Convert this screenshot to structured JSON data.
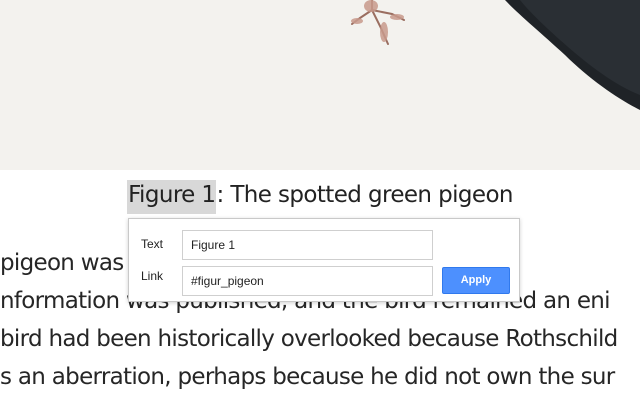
{
  "caption": {
    "figure_label": "Figure 1",
    "rest": ": The spotted green pigeon"
  },
  "body_lines": [
    "pigeon was                                              the  literatu",
    "nformation was published, and the bird remained an eni",
    "bird had been historically overlooked because Rothschild",
    "s an aberration, perhaps because he did not own the sur"
  ],
  "link_popover": {
    "text_label": "Text",
    "text_value": "Figure 1",
    "link_label": "Link",
    "link_value": "#figur_pigeon",
    "apply_label": "Apply"
  },
  "colors": {
    "apply_button": "#4d90fe",
    "selection": "#d8d8d8"
  }
}
